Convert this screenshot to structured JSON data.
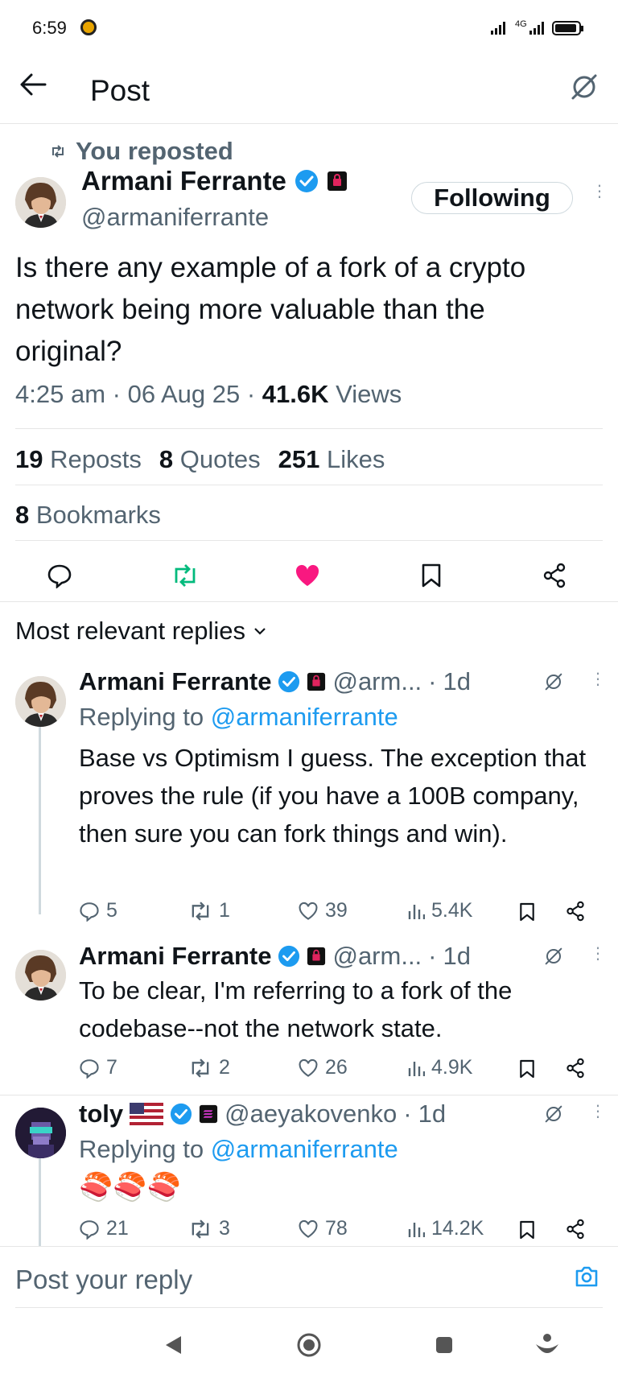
{
  "status_bar": {
    "time": "6:59",
    "network": "4G"
  },
  "header": {
    "title": "Post"
  },
  "post": {
    "repost_label": "You reposted",
    "author_name": "Armani Ferrante",
    "handle": "@armaniferrante",
    "follow_label": "Following",
    "text": "Is there any example of a fork of a crypto network being more valuable than the original?",
    "time": "4:25 am",
    "date": "06 Aug 25",
    "views_count": "41.6K",
    "views_label": "Views",
    "reposts_count": "19",
    "reposts_label": "Reposts",
    "quotes_count": "8",
    "quotes_label": "Quotes",
    "likes_count": "251",
    "likes_label": "Likes",
    "bookmarks_count": "8",
    "bookmarks_label": "Bookmarks",
    "like_color": "#f91880",
    "repost_color": "#00ba7c"
  },
  "replies_section": {
    "title": "Most relevant replies"
  },
  "replies": [
    {
      "author_name": "Armani Ferrante",
      "handle": "@arm...",
      "age": "1d",
      "replying_prefix": "Replying to",
      "replying_to": "@armaniferrante",
      "text": "Base vs Optimism I guess. The exception that proves the rule (if you have a 100B company, then sure you can fork things and win).",
      "replies": "5",
      "reposts": "1",
      "likes": "39",
      "views": "5.4K"
    },
    {
      "author_name": "Armani Ferrante",
      "handle": "@arm...",
      "age": "1d",
      "text": "To be clear, I'm referring to a fork of the codebase--not the network state.",
      "replies": "7",
      "reposts": "2",
      "likes": "26",
      "views": "4.9K"
    },
    {
      "author_name": "toly",
      "handle": "@aeyakovenko",
      "age": "1d",
      "replying_prefix": "Replying to",
      "replying_to": "@armaniferrante",
      "text": "🍣🍣🍣",
      "replies": "21",
      "reposts": "3",
      "likes": "78",
      "views": "14.2K"
    }
  ],
  "reply_bar": {
    "placeholder": "Post your reply"
  },
  "accent_color": "#1d9bf0"
}
